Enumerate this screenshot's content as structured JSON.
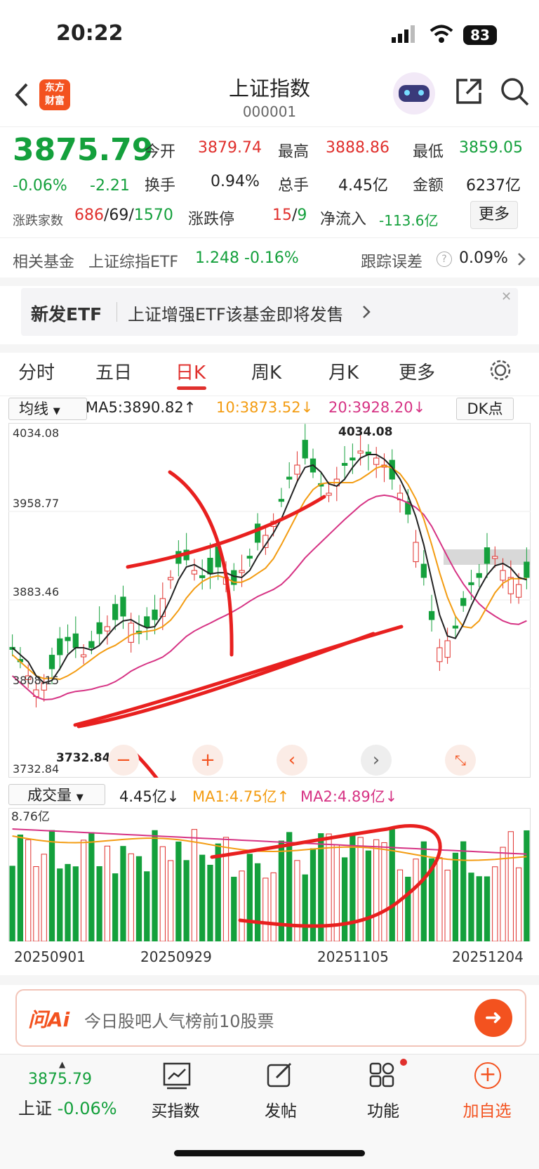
{
  "status_bar": {
    "time": "20:22",
    "battery": "83"
  },
  "header": {
    "logo_line1": "东方",
    "logo_line2": "财富",
    "title": "上证指数",
    "code": "000001"
  },
  "quote": {
    "price": "3875.79",
    "change_pct": "-0.06%",
    "change": "-2.21",
    "open_label": "今开",
    "open": "3879.74",
    "high_label": "最高",
    "high": "3888.86",
    "low_label": "最低",
    "low": "3859.05",
    "turnover_label": "换手",
    "turnover": "0.94%",
    "volume_label": "总手",
    "volume": "4.45亿",
    "amount_label": "金额",
    "amount": "6237亿",
    "breadth_label": "涨跌家数",
    "up_count": "686",
    "flat_count": "69",
    "down_count": "1570",
    "limit_label": "涨跌停",
    "limit_up": "15",
    "limit_down": "9",
    "inflow_label": "净流入",
    "inflow": "-113.6亿",
    "more_label": "更多"
  },
  "fund": {
    "label": "相关基金",
    "name": "上证综指ETF",
    "price": "1.248",
    "change": "-0.16%",
    "tracking_label": "跟踪误差",
    "tracking": "0.09%"
  },
  "promo": {
    "tag": "新发ETF",
    "text": "上证增强ETF该基金即将发售"
  },
  "tabs": [
    "分时",
    "五日",
    "日K",
    "周K",
    "月K",
    "更多"
  ],
  "kline": {
    "ma_select": "均线",
    "ma5": "MA5:3890.82↑",
    "ma10": "10:3873.52↓",
    "ma20": "20:3928.20↓",
    "dk_label": "DK点",
    "y_ticks": [
      "4034.08",
      "3958.77",
      "3883.46",
      "3808.15",
      "3732.84"
    ],
    "max_label": "4034.08",
    "min_label": "3732.84",
    "colors": {
      "up": "#e0302d",
      "down": "#14a03c",
      "ma5": "#222222",
      "ma10": "#f39c12",
      "ma20": "#d63384"
    }
  },
  "volume": {
    "select": "成交量",
    "value": "4.45亿↓",
    "ma1": "MA1:4.75亿↑",
    "ma2": "MA2:4.89亿↓",
    "max_label": "8.76亿",
    "dates": [
      "20250901",
      "20250929",
      "20251105",
      "20251204"
    ]
  },
  "ai": {
    "brand": "问Ai",
    "placeholder": "今日股吧人气榜前10股票"
  },
  "bottom_nav": {
    "price": "3875.79",
    "index_name": "上证",
    "index_change": "-0.06%",
    "buy": "买指数",
    "post": "发帖",
    "features": "功能",
    "add": "加自选"
  }
}
